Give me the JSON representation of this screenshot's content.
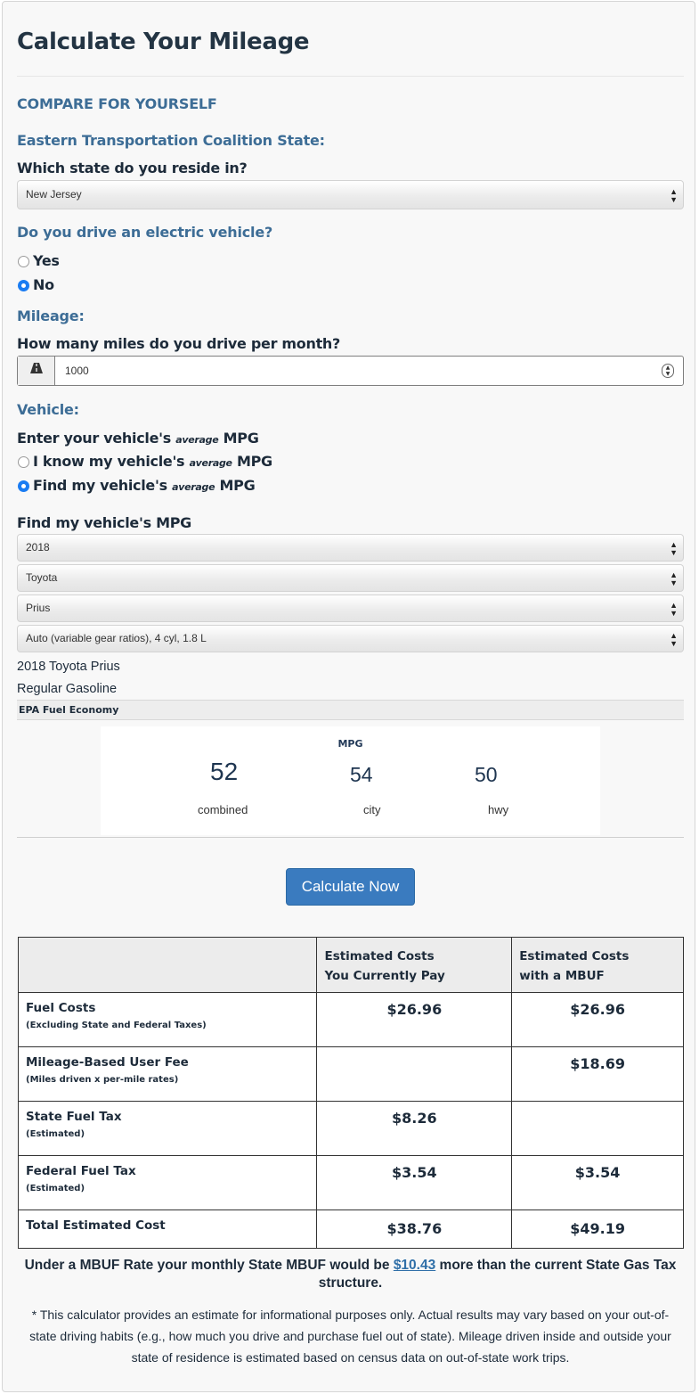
{
  "page": {
    "title": "Calculate Your Mileage",
    "section_heading": "COMPARE FOR YOURSELF"
  },
  "state": {
    "heading": "Eastern Transportation Coalition State:",
    "question": "Which state do you reside in?",
    "selected": "New Jersey"
  },
  "ev": {
    "question": "Do you drive an electric vehicle?",
    "options": [
      {
        "label": "Yes",
        "selected": false
      },
      {
        "label": "No",
        "selected": true
      }
    ]
  },
  "mileage": {
    "heading": "Mileage:",
    "question": "How many miles do you drive per month?",
    "addon_icon": "road-icon",
    "value": "1000"
  },
  "vehicle": {
    "heading": "Vehicle:",
    "question_pre": "Enter your vehicle's",
    "question_small": "average",
    "question_post": "MPG",
    "options": [
      {
        "pre": "I know my vehicle's",
        "small": "average",
        "post": "MPG",
        "selected": false
      },
      {
        "pre": "Find my vehicle's",
        "small": "average",
        "post": "MPG",
        "selected": true
      }
    ],
    "find_heading": "Find my vehicle's MPG",
    "selects": {
      "year": "2018",
      "make": "Toyota",
      "model": "Prius",
      "trim": "Auto (variable gear ratios), 4 cyl, 1.8 L"
    },
    "name": "2018 Toyota Prius",
    "fuel": "Regular Gasoline"
  },
  "epa": {
    "bar_label": "EPA Fuel Economy",
    "mpg_label": "MPG",
    "combined": {
      "value": "52",
      "label": "combined"
    },
    "city": {
      "value": "54",
      "label": "city"
    },
    "hwy": {
      "value": "50",
      "label": "hwy"
    }
  },
  "calculate_label": "Calculate Now",
  "table": {
    "headers": [
      "",
      "Estimated Costs You Currently Pay",
      "Estimated Costs with a MBUF"
    ],
    "header_lines": {
      "current": [
        "Estimated Costs",
        "You Currently Pay"
      ],
      "mbuf": [
        "Estimated Costs",
        "with a MBUF"
      ]
    },
    "rows": [
      {
        "title": "Fuel Costs",
        "sub": "(Excluding State and Federal Taxes)",
        "current": "$26.96",
        "mbuf": "$26.96"
      },
      {
        "title": "Mileage-Based User Fee",
        "sub": "(Miles driven x per-mile rates)",
        "current": "",
        "mbuf": "$18.69"
      },
      {
        "title": "State Fuel Tax",
        "sub": "(Estimated)",
        "current": "$8.26",
        "mbuf": ""
      },
      {
        "title": "Federal Fuel Tax",
        "sub": "(Estimated)",
        "current": "$3.54",
        "mbuf": "$3.54"
      },
      {
        "title": "Total Estimated Cost",
        "sub": "",
        "current": "$38.76",
        "mbuf": "$49.19"
      }
    ]
  },
  "summary": {
    "pre": "Under a MBUF Rate your monthly State MBUF would be",
    "amount": "$10.43",
    "post": "more than the current State Gas Tax structure."
  },
  "disclaimer": "* This calculator provides an estimate for informational purposes only. Actual results may vary based on your out-of-state driving habits (e.g., how much you drive and purchase fuel out of state). Mileage driven inside and outside your state of residence is estimated based on census data on out-of-state work trips.",
  "colors": {
    "section_blue": "#3d6d96",
    "radio_blue": "#1a7cf2",
    "button_blue": "#3a7bbf",
    "text_dark": "#1d2b3a"
  }
}
